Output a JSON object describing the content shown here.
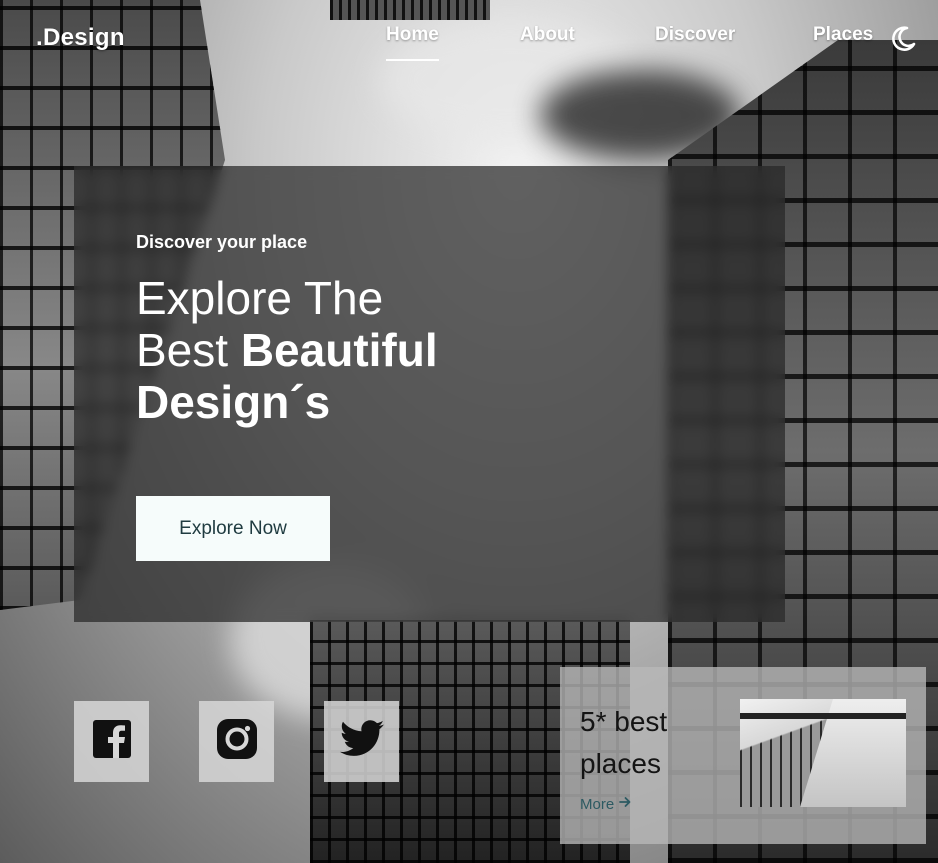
{
  "header": {
    "logo": ".Design",
    "nav": [
      {
        "label": "Home",
        "active": true
      },
      {
        "label": "About",
        "active": false
      },
      {
        "label": "Discover",
        "active": false
      },
      {
        "label": "Places",
        "active": false
      }
    ],
    "theme_toggle_icon": "moon-icon"
  },
  "hero": {
    "kicker": "Discover your place",
    "title_line1": "Explore The",
    "title_line2_light": "Best",
    "title_line2_bold": "Beautiful",
    "title_line3_bold": "Design´s",
    "cta_label": "Explore Now"
  },
  "social": [
    {
      "icon": "facebook-icon"
    },
    {
      "icon": "instagram-icon"
    },
    {
      "icon": "twitter-icon"
    }
  ],
  "places_card": {
    "title": "5* best places",
    "more_label": "More",
    "more_icon": "arrow-right-icon"
  },
  "colors": {
    "cta_bg": "#f6fcfb",
    "cta_text": "#1f3b40",
    "more_link": "#2d5a62",
    "overlay": "#282828"
  }
}
